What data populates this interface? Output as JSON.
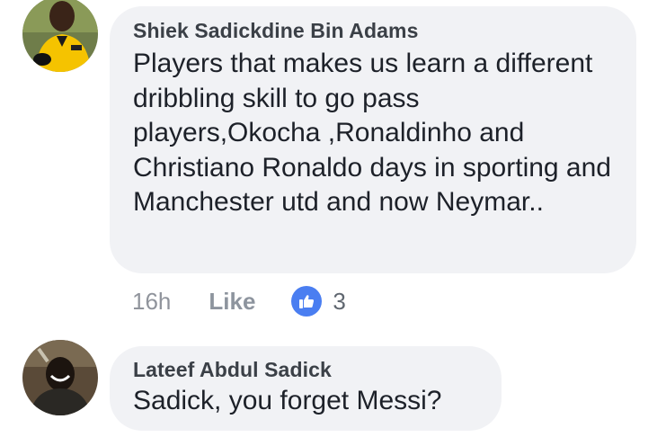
{
  "comments": [
    {
      "author": "Shiek Sadickdine Bin Adams",
      "text": "Players that makes us learn a different dribbling skill to go pass players,Okocha ,Ronaldinho and Christiano Ronaldo days in sporting and Manchester utd and now Neymar..",
      "timestamp": "16h",
      "like_label": "Like",
      "reaction_icon": "thumbs-up-icon",
      "reaction_count": "3"
    },
    {
      "author": "Lateef Abdul Sadick",
      "text": "Sadick, you forget Messi?"
    }
  ],
  "colors": {
    "bubble": "#f1f2f5",
    "author": "#3b4047",
    "text": "#1d2129",
    "meta": "#90949c",
    "like_badge": "#4a7ef1"
  }
}
